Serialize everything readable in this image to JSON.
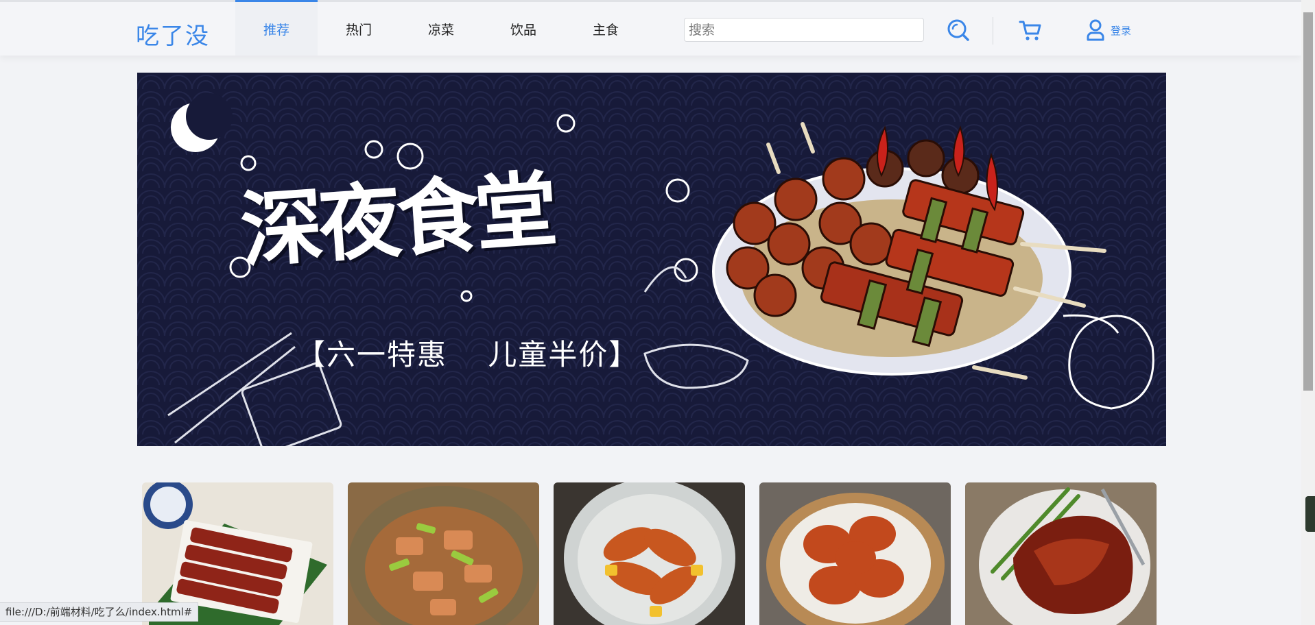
{
  "header": {
    "logo": "吃了没",
    "nav": [
      {
        "label": "推荐",
        "active": true
      },
      {
        "label": "热门",
        "active": false
      },
      {
        "label": "凉菜",
        "active": false
      },
      {
        "label": "饮品",
        "active": false
      },
      {
        "label": "主食",
        "active": false
      }
    ],
    "search_placeholder": "搜索",
    "search_icon": "search-icon",
    "cart_icon": "cart-icon",
    "login_label": "登录",
    "accent_color": "#3a86e8"
  },
  "banner": {
    "title": "深夜食堂",
    "promo": "【六一特惠　 儿童半价】",
    "background": "#171a39"
  },
  "dishes": [
    {
      "name": "dish-ribs"
    },
    {
      "name": "dish-stir-fry"
    },
    {
      "name": "dish-wings"
    },
    {
      "name": "dish-fried-chicken"
    },
    {
      "name": "dish-roast-duck"
    }
  ],
  "status_url": "file:///D:/前端材料/吃了么/index.html#"
}
